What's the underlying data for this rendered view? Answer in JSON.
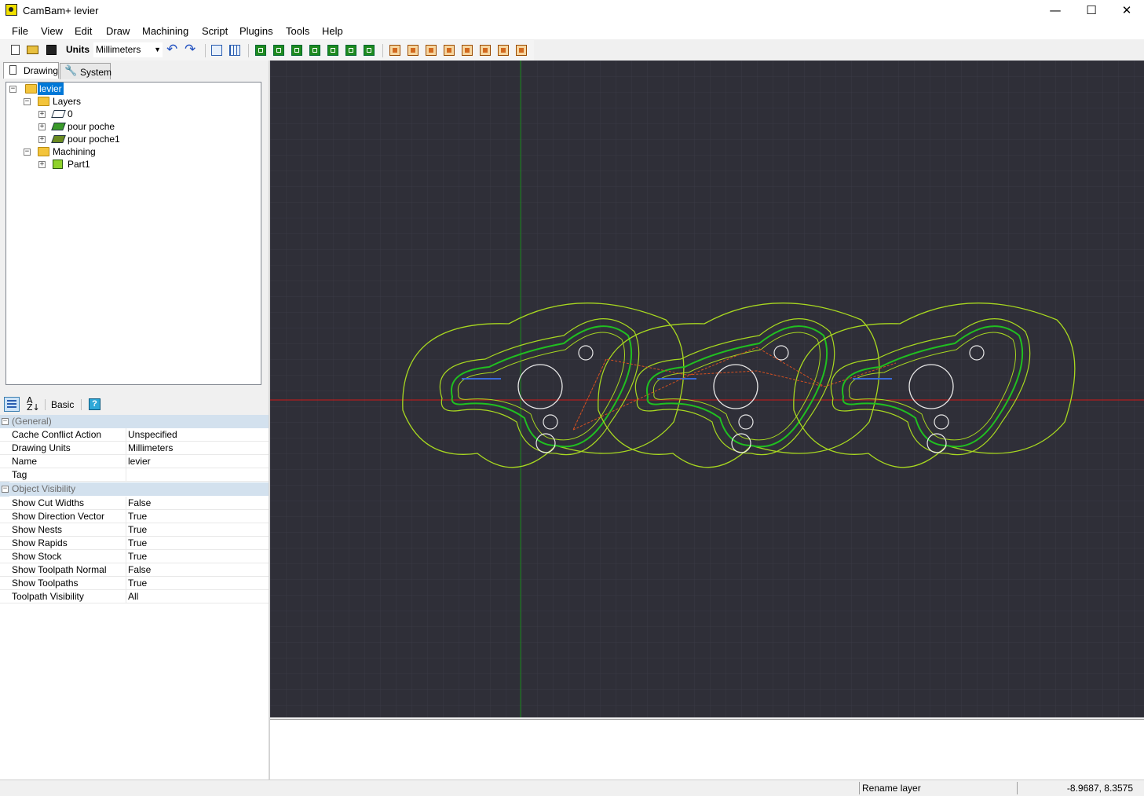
{
  "window": {
    "title": "CamBam+  levier",
    "minimize_glyph": "—",
    "maximize_glyph": "☐",
    "close_glyph": "✕"
  },
  "menu": [
    "File",
    "View",
    "Edit",
    "Draw",
    "Machining",
    "Script",
    "Plugins",
    "Tools",
    "Help"
  ],
  "toolbar": {
    "units_label": "Units",
    "units_value": "Millimeters",
    "undo_glyph": "↶",
    "redo_glyph": "↷",
    "icons": [
      "new-file-icon",
      "open-folder-icon",
      "save-icon",
      "undo-icon",
      "redo-icon",
      "snap-icon",
      "grid-icon",
      "profile-icon",
      "pocket-icon",
      "drill-icon",
      "engrave-icon",
      "text-icon",
      "lathe-icon",
      "3d-profile-icon",
      "gcode-icon",
      "toolpath-icon",
      "post-icon",
      "stock-icon",
      "cut-icon",
      "nest-icon",
      "cam-icon",
      "style-icon"
    ]
  },
  "tabs": {
    "drawing": "Drawing",
    "system": "System"
  },
  "tree": {
    "root": "levier",
    "layers": "Layers",
    "layer_items": [
      "0",
      "pour poche",
      "pour poche1"
    ],
    "machining": "Machining",
    "parts": [
      "Part1"
    ]
  },
  "prop_toolbar": {
    "basic_label": "Basic",
    "help_glyph": "?"
  },
  "properties": {
    "general": {
      "title": "(General)",
      "rows": [
        {
          "name": "Cache Conflict Action",
          "value": "Unspecified"
        },
        {
          "name": "Drawing Units",
          "value": "Millimeters"
        },
        {
          "name": "Name",
          "value": "levier"
        },
        {
          "name": "Tag",
          "value": ""
        }
      ]
    },
    "visibility": {
      "title": "Object Visibility",
      "rows": [
        {
          "name": "Show Cut Widths",
          "value": "False"
        },
        {
          "name": "Show Direction Vector",
          "value": "True"
        },
        {
          "name": "Show Nests",
          "value": "True"
        },
        {
          "name": "Show Rapids",
          "value": "True"
        },
        {
          "name": "Show Stock",
          "value": "True"
        },
        {
          "name": "Show Toolpath Normal",
          "value": "False"
        },
        {
          "name": "Show Toolpaths",
          "value": "True"
        },
        {
          "name": "Toolpath Visibility",
          "value": "All"
        }
      ]
    }
  },
  "status": {
    "message": "Rename layer",
    "coords": "-8.9687, 8.3575"
  },
  "colors": {
    "viewport_bg": "#2f2f38",
    "grid": "#3b3b46",
    "x_axis": "#d01818",
    "y_axis": "#1a8a1a",
    "outline": "#a8d820",
    "toolpath": "#20c020",
    "lead_in": "#3a6ad8",
    "rapid": "#d85020",
    "hole": "#e8e8e8"
  }
}
